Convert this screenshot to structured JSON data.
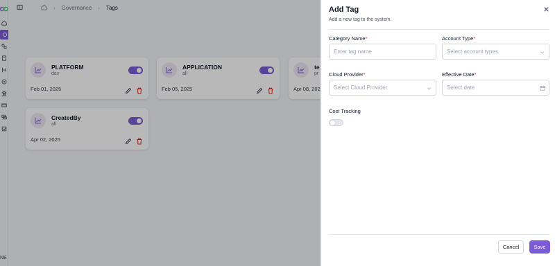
{
  "sidebar": {
    "items": [
      {
        "icon": "home-icon"
      },
      {
        "icon": "tag-icon",
        "active": true
      },
      {
        "icon": "link-icon"
      },
      {
        "icon": "document-icon"
      },
      {
        "icon": "branch-icon"
      },
      {
        "icon": "palette-icon"
      },
      {
        "icon": "building-icon"
      },
      {
        "icon": "card-icon"
      },
      {
        "icon": "chat-icon"
      },
      {
        "icon": "report-icon"
      }
    ],
    "bottom_text": "NE"
  },
  "breadcrumb": {
    "items": [
      "Governance",
      "Tags"
    ]
  },
  "cards": [
    {
      "title": "PLATFORM",
      "sub": "dev",
      "date": "Feb 01, 2025",
      "enabled": true
    },
    {
      "title": "APPLICATION",
      "sub": "all",
      "date": "Feb 05, 2025",
      "enabled": true
    },
    {
      "title": "te",
      "sub": "pr",
      "date": "Apr 08, 2025",
      "enabled": true
    },
    {
      "title": "CreatedBy",
      "sub": "all",
      "date": "Apr 02, 2025",
      "enabled": true
    }
  ],
  "drawer": {
    "title": "Add Tag",
    "subtitle": "Add a new tag to the system.",
    "fields": {
      "category_name": {
        "label": "Category Name",
        "required": "*",
        "placeholder": "Enter tag name",
        "value": ""
      },
      "account_type": {
        "label": "Account Type",
        "required": "*",
        "placeholder": "Select account types"
      },
      "cloud_provider": {
        "label": "Cloud Provider",
        "required": "*",
        "placeholder": "Select Cloud Provider"
      },
      "effective_date": {
        "label": "Effective Date",
        "required": "*",
        "placeholder": "Select date"
      },
      "cost_tracking": {
        "label": "Cost Tracking",
        "enabled": false
      }
    },
    "buttons": {
      "cancel": "Cancel",
      "save": "Save"
    }
  },
  "colors": {
    "accent": "#7c5cd6",
    "required": "#e11d48"
  }
}
